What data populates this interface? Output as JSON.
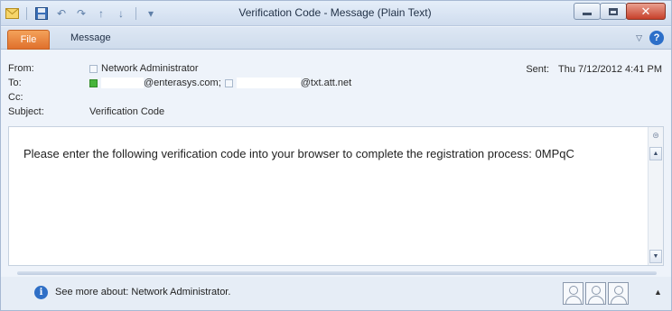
{
  "window": {
    "title": "Verification Code - Message (Plain Text)"
  },
  "ribbon": {
    "file_tab": "File",
    "message_tab": "Message"
  },
  "header": {
    "from_label": "From:",
    "from_value": "Network Administrator",
    "to_label": "To:",
    "to_recipient_1": "@enterasys.com;",
    "to_recipient_2": "@txt.att.net",
    "cc_label": "Cc:",
    "subject_label": "Subject:",
    "subject_value": "Verification Code",
    "sent_label": "Sent:",
    "sent_value": "Thu 7/12/2012 4:41 PM"
  },
  "message": {
    "body": "Please enter the following verification code into your browser to complete the registration process: 0MPqC"
  },
  "people_pane": {
    "text": "See more about: Network Administrator."
  },
  "icons": {
    "app": "mail-icon",
    "save": "save-icon",
    "undo": "undo-icon",
    "redo": "redo-icon",
    "info": "info-icon"
  },
  "colors": {
    "file_tab": "#e0702c",
    "close_button": "#c7402a",
    "presence_online": "#47b43a",
    "info": "#2f6fc6"
  }
}
